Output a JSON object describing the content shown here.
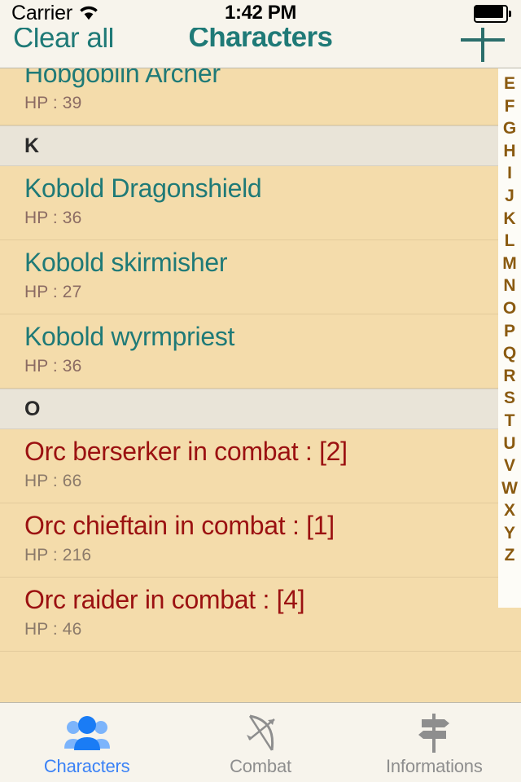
{
  "status_bar": {
    "carrier": "Carrier",
    "wifi_icon": "wifi-icon",
    "time": "1:42 PM",
    "battery_icon": "battery-full-icon"
  },
  "nav_bar": {
    "left_button": "Clear all",
    "title": "Characters",
    "right_button_icon": "plus-icon"
  },
  "colors": {
    "accent_teal": "#1f7a77",
    "combat_red": "#9b1111",
    "row_background": "#f4dcab",
    "section_background": "#e9e4d8",
    "chrome_background": "#f7f4ec",
    "index_letter": "#8a5a10",
    "active_tab": "#3b82f6"
  },
  "list": {
    "items": [
      {
        "kind": "row",
        "title": "Hobgoblin Archer",
        "hp_label": "HP : 39",
        "combat": false,
        "clipped": true
      },
      {
        "kind": "section",
        "title": "K"
      },
      {
        "kind": "row",
        "title": "Kobold Dragonshield",
        "hp_label": "HP : 36",
        "combat": false,
        "clipped": false
      },
      {
        "kind": "row",
        "title": "Kobold skirmisher",
        "hp_label": "HP : 27",
        "combat": false,
        "clipped": false
      },
      {
        "kind": "row",
        "title": "Kobold wyrmpriest",
        "hp_label": "HP : 36",
        "combat": false,
        "clipped": false
      },
      {
        "kind": "section",
        "title": "O"
      },
      {
        "kind": "row",
        "title": "Orc berserker in combat : [2]",
        "hp_label": "HP : 66",
        "combat": true,
        "clipped": false
      },
      {
        "kind": "row",
        "title": "Orc chieftain in combat : [1]",
        "hp_label": "HP : 216",
        "combat": true,
        "clipped": false
      },
      {
        "kind": "row",
        "title": "Orc raider in combat : [4]",
        "hp_label": "HP : 46",
        "combat": true,
        "clipped": false
      }
    ]
  },
  "index_bar": {
    "letters": [
      "E",
      "F",
      "G",
      "H",
      "I",
      "J",
      "K",
      "L",
      "M",
      "N",
      "O",
      "P",
      "Q",
      "R",
      "S",
      "T",
      "U",
      "V",
      "W",
      "X",
      "Y",
      "Z"
    ]
  },
  "tab_bar": {
    "tabs": [
      {
        "label": "Characters",
        "icon": "people-group-icon",
        "active": true
      },
      {
        "label": "Combat",
        "icon": "bow-and-arrow-icon",
        "active": false
      },
      {
        "label": "Informations",
        "icon": "signpost-icon",
        "active": false
      }
    ]
  }
}
